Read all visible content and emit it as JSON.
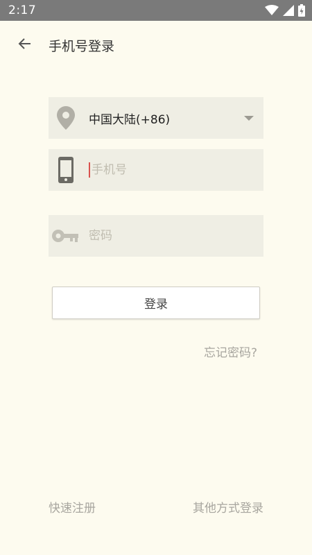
{
  "status_bar": {
    "time": "2:17"
  },
  "app_bar": {
    "title": "手机号登录"
  },
  "form": {
    "region": {
      "value": "中国大陆(+86)"
    },
    "phone": {
      "placeholder": "手机号",
      "value": ""
    },
    "password": {
      "placeholder": "密码",
      "value": ""
    },
    "login_label": "登录",
    "forgot_password": "忘记密码?"
  },
  "footer": {
    "quick_register": "快速注册",
    "other_login": "其他方式登录"
  },
  "colors": {
    "background": "#fdfbef",
    "field_background": "#efeee4",
    "icon": "#9c9a92",
    "cursor": "#d9534f",
    "status_bar": "#7a7a7a"
  },
  "icons": {
    "back": "arrow-left-icon",
    "region": "location-pin-icon",
    "phone": "smartphone-icon",
    "password": "key-icon",
    "dropdown": "caret-down-icon"
  }
}
